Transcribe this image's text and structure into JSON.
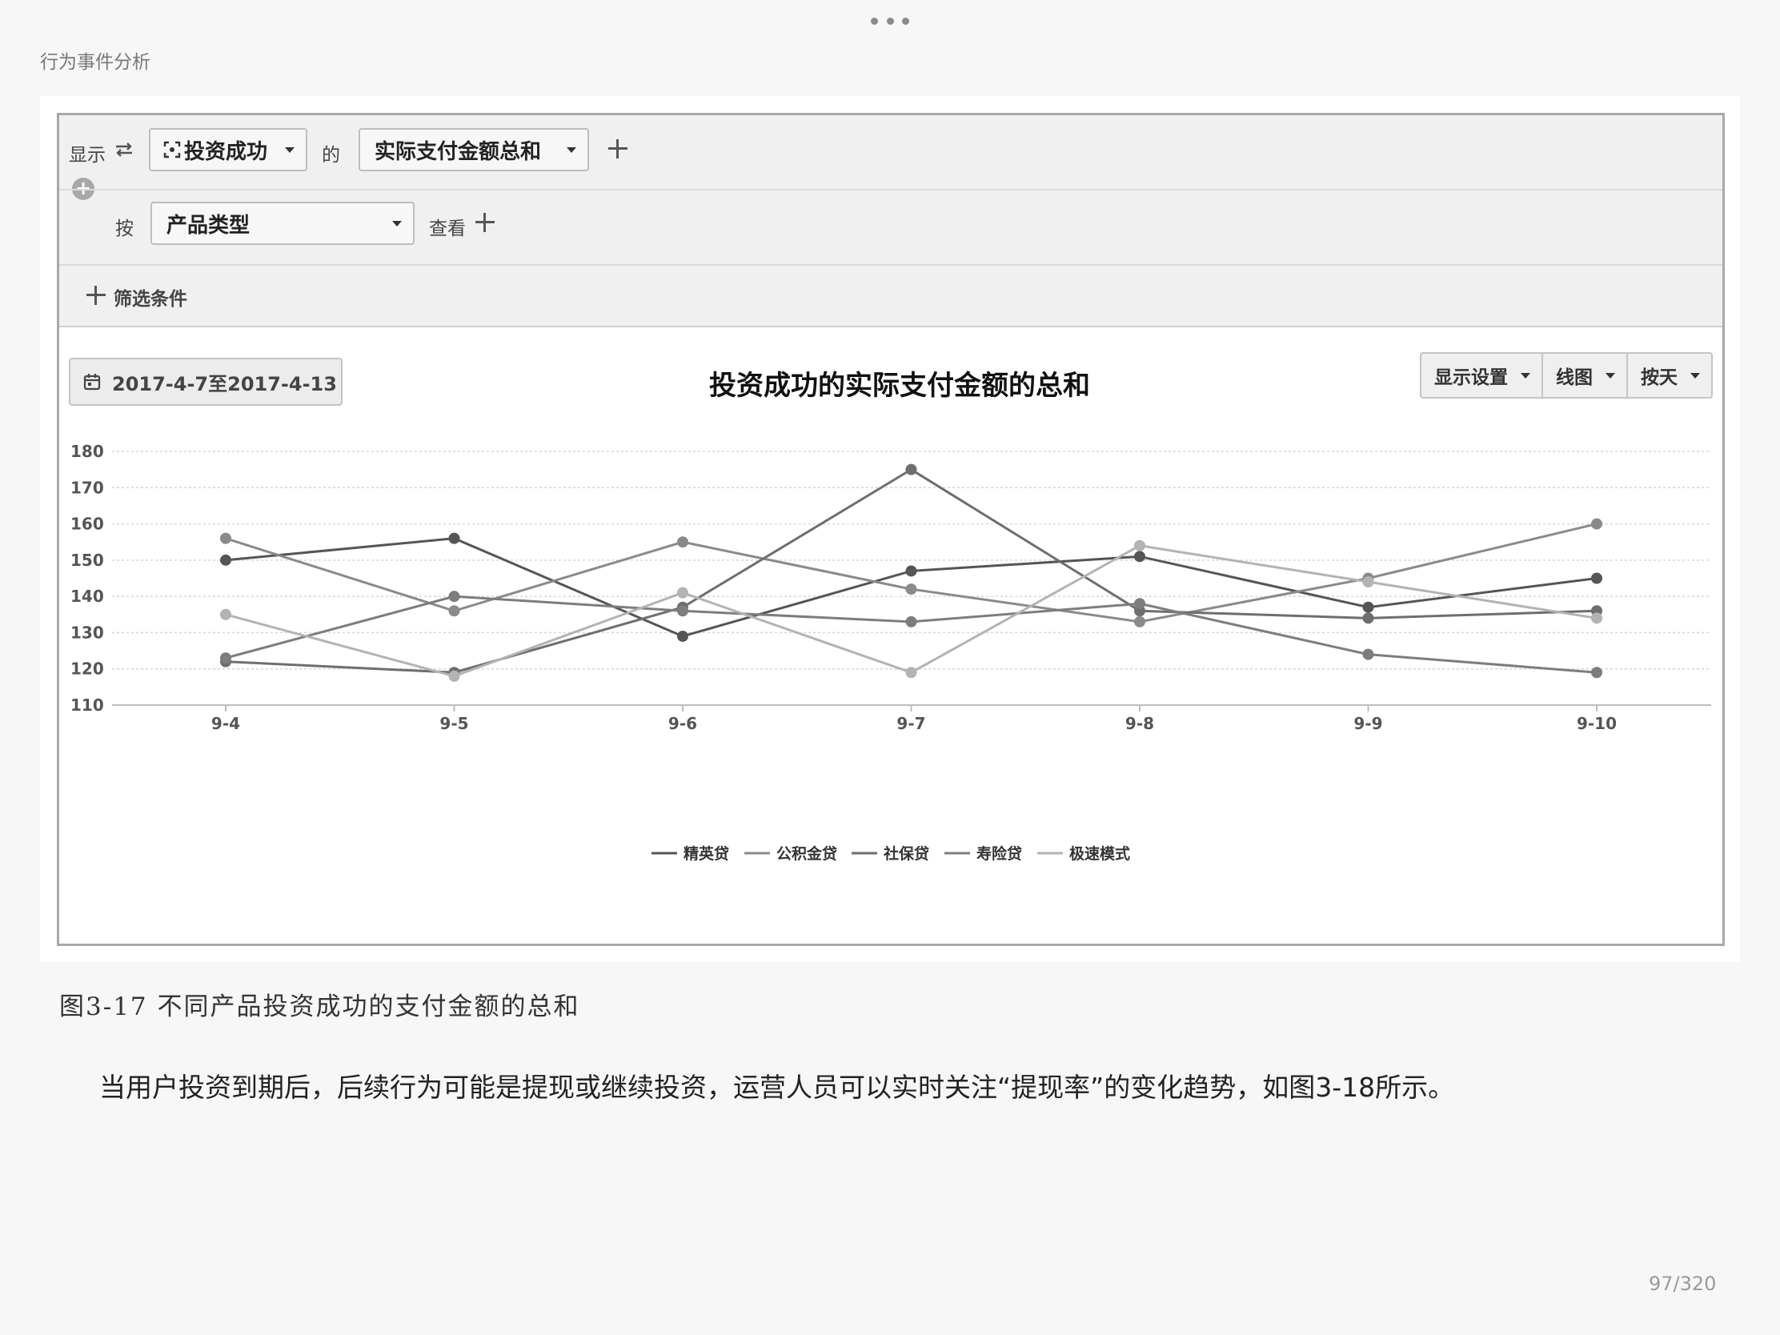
{
  "book": {
    "title": "行为事件分析",
    "page_indicator": "97/320"
  },
  "query": {
    "show_label": "显示",
    "event_value": "投资成功",
    "of_label": "的",
    "metric_value": "实际支付金额总和",
    "by_label": "按",
    "group_value": "产品类型",
    "view_label": "查看",
    "filter_label": "筛选条件"
  },
  "toolbar": {
    "date_range": "2017-4-7至2017-4-13",
    "display_settings": "显示设置",
    "chart_type": "线图",
    "granularity": "按天"
  },
  "chart_data": {
    "type": "line",
    "title": "投资成功的实际支付金额的总和",
    "xlabel": "",
    "ylabel": "",
    "categories": [
      "9-4",
      "9-5",
      "9-6",
      "9-7",
      "9-8",
      "9-9",
      "9-10"
    ],
    "ylim": [
      110,
      180
    ],
    "yticks": [
      180,
      170,
      160,
      150,
      140,
      130,
      120,
      110
    ],
    "grid": true,
    "legend_position": "bottom",
    "series": [
      {
        "name": "精英贷",
        "color": "#555555",
        "values": [
          150,
          156,
          129,
          147,
          151,
          137,
          145
        ]
      },
      {
        "name": "公积金贷",
        "color": "#8a8a8a",
        "values": [
          156,
          136,
          155,
          142,
          133,
          145,
          160
        ]
      },
      {
        "name": "社保贷",
        "color": "#6e6e6e",
        "values": [
          122,
          119,
          137,
          175,
          136,
          134,
          136
        ]
      },
      {
        "name": "寿险贷",
        "color": "#7d7d7d",
        "values": [
          123,
          140,
          136,
          133,
          138,
          124,
          119
        ]
      },
      {
        "name": "极速模式",
        "color": "#b3b3b3",
        "values": [
          135,
          118,
          141,
          119,
          154,
          144,
          134
        ]
      }
    ]
  },
  "figure": {
    "caption": "图3-17 不同产品投资成功的支付金额的总和"
  },
  "body_text": {
    "paragraph": "当用户投资到期后，后续行为可能是提现或继续投资，运营人员可以实时关注“提现率”的变化趋势，如图3-18所示。"
  }
}
